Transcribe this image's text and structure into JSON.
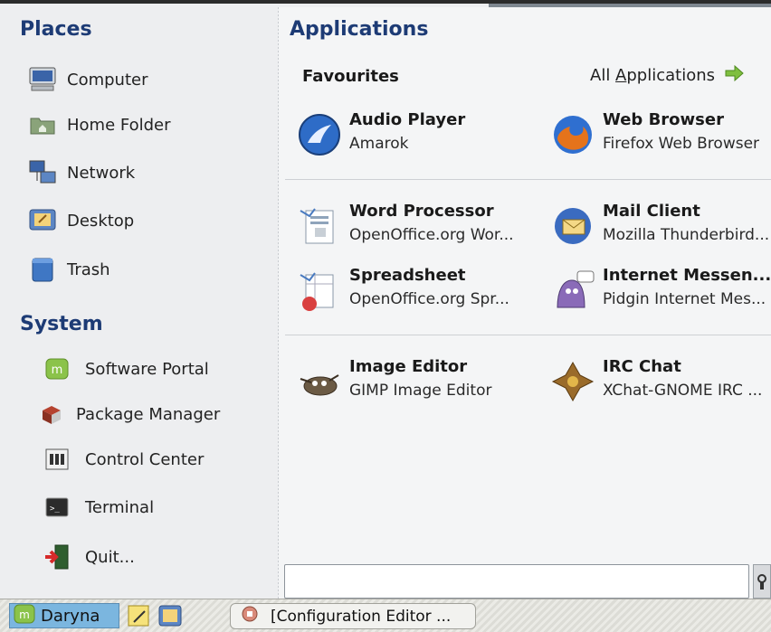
{
  "places": {
    "title": "Places",
    "items": [
      {
        "label": "Computer",
        "icon": "computer-icon"
      },
      {
        "label": "Home Folder",
        "icon": "home-folder-icon"
      },
      {
        "label": "Network",
        "icon": "network-icon"
      },
      {
        "label": "Desktop",
        "icon": "desktop-icon"
      },
      {
        "label": "Trash",
        "icon": "trash-icon"
      }
    ]
  },
  "system": {
    "title": "System",
    "items": [
      {
        "label": "Software Portal",
        "icon": "software-portal-icon"
      },
      {
        "label": "Package Manager",
        "icon": "package-manager-icon"
      },
      {
        "label": "Control Center",
        "icon": "control-center-icon"
      },
      {
        "label": "Terminal",
        "icon": "terminal-icon"
      },
      {
        "label": "Quit...",
        "icon": "quit-icon"
      }
    ]
  },
  "applications": {
    "title": "Applications",
    "favourites_label": "Favourites",
    "all_apps_prefix": "All ",
    "all_apps_accel": "A",
    "all_apps_rest": "pplications",
    "apps": [
      {
        "name": "Audio Player",
        "desc": "Amarok",
        "icon": "audio-player-icon"
      },
      {
        "name": "Web Browser",
        "desc": "Firefox Web Browser",
        "icon": "web-browser-icon"
      },
      {
        "name": "Word Processor",
        "desc": "OpenOffice.org Wor...",
        "icon": "word-processor-icon"
      },
      {
        "name": "Mail Client",
        "desc": "Mozilla Thunderbird...",
        "icon": "mail-client-icon"
      },
      {
        "name": "Spreadsheet",
        "desc": "OpenOffice.org Spr...",
        "icon": "spreadsheet-icon"
      },
      {
        "name": "Internet Messen...",
        "desc": "Pidgin Internet Mes...",
        "icon": "messenger-icon"
      },
      {
        "name": "Image Editor",
        "desc": "GIMP Image Editor",
        "icon": "image-editor-icon"
      },
      {
        "name": "IRC Chat",
        "desc": "XChat-GNOME IRC ...",
        "icon": "irc-chat-icon"
      }
    ]
  },
  "search": {
    "value": ""
  },
  "panel": {
    "menu_label": "Daryna",
    "task_label": "[Configuration Editor ..."
  },
  "colors": {
    "accent": "#1d3b75",
    "menu_button": "#7bb6df"
  }
}
